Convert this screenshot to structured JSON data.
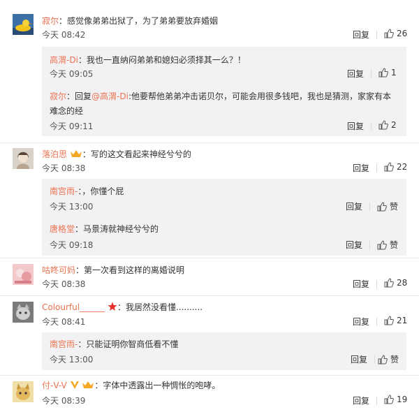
{
  "labels": {
    "reply": "回复",
    "like_zero": "赞"
  },
  "comments": [
    {
      "user": "寂尔",
      "text": "：感觉像弟弟出狱了，为了弟弟要放弃婚姻",
      "time": "今天 08:42",
      "likes": "26",
      "avatar": "avatar-yellow-duck",
      "replies": [
        {
          "user": "高渭-Di",
          "text": "：我也一直纳闷弟弟和媳妇必须择其一么？！",
          "time": "今天 09:05",
          "likes": "1"
        },
        {
          "user": "寂尔",
          "text_prefix": "：回复",
          "mention": "@高渭-Di",
          "text": ":他要帮他弟弟冲击诺贝尔，可能会用很多钱吧，我也是猜测，家家有本",
          "text2": "难念的经",
          "time": "今天 09:11",
          "likes": "2"
        }
      ]
    },
    {
      "user": "落泊思",
      "text": "：写的这文看起来神经兮兮的",
      "time": "今天 08:38",
      "likes": "22",
      "avatar": "avatar-woman",
      "replies": [
        {
          "user": "南宫雨-",
          "text": "：，你懂个屁",
          "time": "今天 13:00",
          "likes": "赞"
        },
        {
          "user": "唐格堂",
          "text": "：马景涛就神经兮兮的",
          "time": "今天 09:18",
          "likes": "赞"
        }
      ]
    },
    {
      "user": "咕咚可妈",
      "text": "：第一次看到这样的离婚说明",
      "time": "今天 08:38",
      "likes": "28",
      "avatar": "avatar-pink",
      "replies": []
    },
    {
      "user": "Colourful______",
      "text": "：我居然没看懂..........",
      "time": "今天 08:41",
      "likes": "21",
      "avatar": "avatar-cat",
      "replies": [
        {
          "user": "南宫雨-",
          "text": "：只能证明你智商低看不懂",
          "time": "今天 13:00",
          "likes": "赞"
        }
      ]
    },
    {
      "user": "付-V-V",
      "text": "：字体中透露出一种惆怅的咆哮。",
      "time": "今天 08:39",
      "likes": "19",
      "avatar": "avatar-dog",
      "replies": []
    }
  ],
  "colors": {
    "username": "#eb7350",
    "reply_bg": "#f2f2f5",
    "star": "#e8322b",
    "vip": "#f5a623"
  }
}
